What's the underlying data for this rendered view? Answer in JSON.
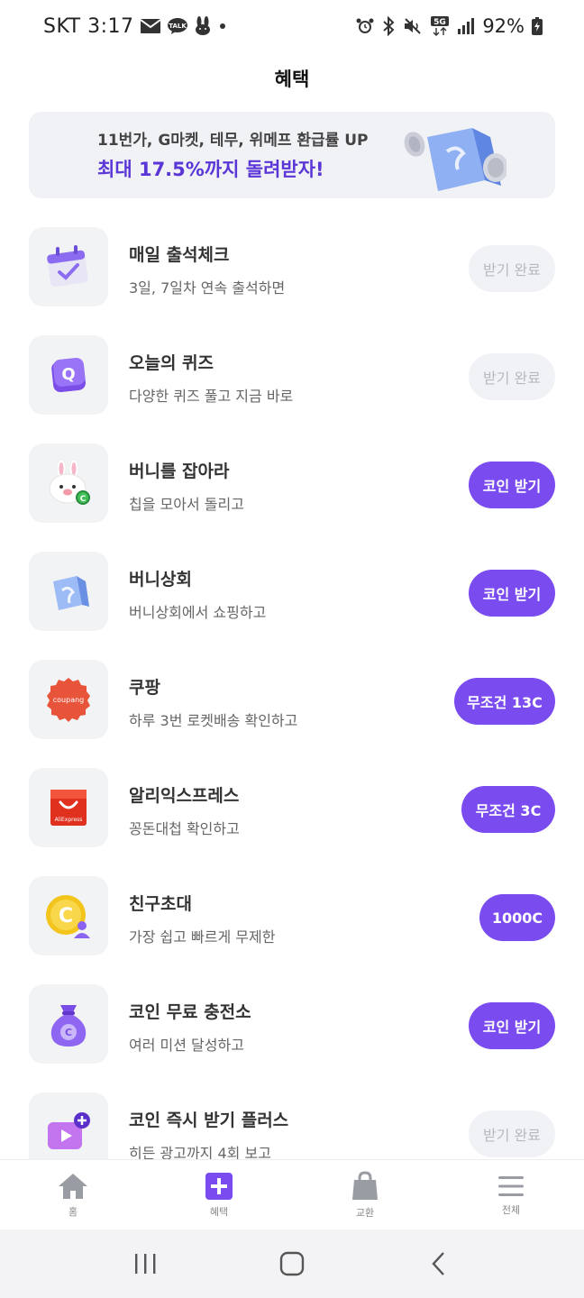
{
  "status_bar": {
    "carrier_time": "SKT 3:17",
    "battery": "92%",
    "network": "5G"
  },
  "header": {
    "title": "혜택"
  },
  "banner": {
    "line1": "11번가, G마켓, 테무, 위메프 환급률 UP",
    "line2": "최대 17.5%까지 돌려받자!"
  },
  "items": [
    {
      "title": "매일 출석체크",
      "subtitle": "3일, 7일차 연속 출석하면",
      "button": "받기 완료",
      "state": "done",
      "icon": "calendar-icon"
    },
    {
      "title": "오늘의 퀴즈",
      "subtitle": "다양한 퀴즈 풀고 지금 바로",
      "button": "받기 완료",
      "state": "done",
      "icon": "quiz-icon"
    },
    {
      "title": "버니를 잡아라",
      "subtitle": "칩을 모아서 돌리고",
      "button": "코인 받기",
      "state": "active",
      "icon": "bunny-icon"
    },
    {
      "title": "버니상회",
      "subtitle": "버니상회에서 쇼핑하고",
      "button": "코인 받기",
      "state": "active",
      "icon": "shop-bag-icon"
    },
    {
      "title": "쿠팡",
      "subtitle": "하루 3번 로켓배송 확인하고",
      "button": "무조건 13C",
      "state": "active",
      "icon": "coupang-logo-icon",
      "logo_text": "coupang"
    },
    {
      "title": "알리익스프레스",
      "subtitle": "꽁돈대첩 확인하고",
      "button": "무조건 3C",
      "state": "active",
      "icon": "aliexpress-logo-icon",
      "logo_text": "AliExpress"
    },
    {
      "title": "친구초대",
      "subtitle": "가장 쉽고 빠르게 무제한",
      "button": "1000C",
      "state": "active",
      "icon": "coin-friend-icon"
    },
    {
      "title": "코인 무료 충전소",
      "subtitle": "여러 미션 달성하고",
      "button": "코인 받기",
      "state": "active",
      "icon": "coin-pouch-icon"
    },
    {
      "title": "코인 즉시 받기 플러스",
      "subtitle": "히든 광고까지 4회 보고",
      "button": "받기 완료",
      "state": "done",
      "icon": "video-plus-icon"
    }
  ],
  "bottom_nav": [
    {
      "label": "홈",
      "icon": "home-icon"
    },
    {
      "label": "혜택",
      "icon": "plus-box-icon"
    },
    {
      "label": "교환",
      "icon": "shopping-bag-icon"
    },
    {
      "label": "전체",
      "icon": "menu-icon"
    }
  ],
  "colors": {
    "accent": "#7a4cf0",
    "banner_text": "#5a36d6",
    "done_bg": "#f1f2f5"
  }
}
